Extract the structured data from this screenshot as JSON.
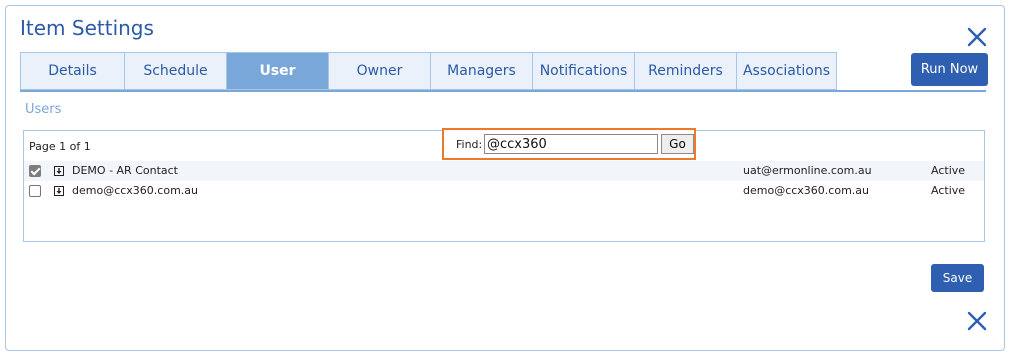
{
  "dialog": {
    "title": "Item Settings"
  },
  "tabs": [
    {
      "label": "Details",
      "width": 0
    },
    {
      "label": "Schedule"
    },
    {
      "label": "User"
    },
    {
      "label": "Owner"
    },
    {
      "label": "Managers"
    },
    {
      "label": "Notifications"
    },
    {
      "label": "Reminders"
    },
    {
      "label": "Associations"
    }
  ],
  "active_tab": "User",
  "toolbar": {
    "run_now_label": "Run Now",
    "save_label": "Save"
  },
  "section": {
    "label": "Users"
  },
  "pager": {
    "text": "Page 1 of 1"
  },
  "find": {
    "label": "Find:",
    "value": "@ccx360",
    "go_label": "Go"
  },
  "users": [
    {
      "checked": true,
      "name": "DEMO - AR Contact",
      "email": "uat@ermonline.com.au",
      "status": "Active"
    },
    {
      "checked": false,
      "name": "demo@ccx360.com.au",
      "email": "demo@ccx360.com.au",
      "status": "Active"
    }
  ],
  "colors": {
    "accent": "#2e5fb0",
    "active_tab": "#7aa7da",
    "highlight_border": "#ec7a29"
  },
  "icons": {
    "close": "close-icon",
    "expand": "expand-arrow-icon"
  }
}
